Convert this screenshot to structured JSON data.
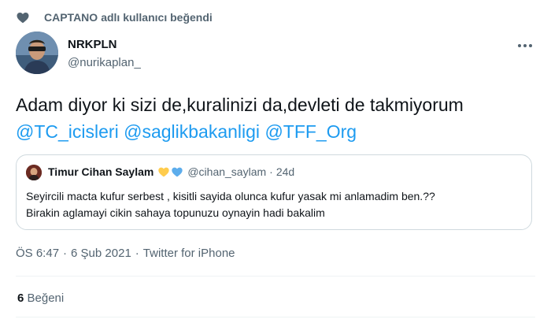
{
  "liked_banner": {
    "liker": "CAPTANO",
    "text": "adlı kullanıcı beğendi",
    "icon": "heart-icon"
  },
  "author": {
    "name": "NRKPLN",
    "handle": "@nurikaplan_"
  },
  "tweet": {
    "text_prefix": "Adam diyor ki sizi de,kuralinizi da,devleti de takmiyorum ",
    "mentions": [
      "@TC_icisleri",
      "@saglikbakanligi",
      "@TFF_Org"
    ]
  },
  "quote": {
    "name": "Timur Cihan Saylam",
    "hearts": [
      "yellow-heart",
      "blue-heart"
    ],
    "handle": "@cihan_saylam",
    "time": "24d",
    "line1": "Seyircili macta kufur serbest , kisitli sayida olunca kufur yasak mi anlamadim ben.??",
    "line2": "Birakin aglamayi cikin sahaya topunuzu oynayin hadi bakalim"
  },
  "meta": {
    "time": "ÖS 6:47",
    "date": "6 Şub 2021",
    "source": "Twitter for iPhone"
  },
  "likes": {
    "count": "6",
    "label": "Beğeni"
  },
  "colors": {
    "accent": "#1d9bf0",
    "muted": "#536471",
    "text": "#0f1419",
    "yellow_heart": "#ffcc4d",
    "blue_heart": "#5dadec"
  }
}
